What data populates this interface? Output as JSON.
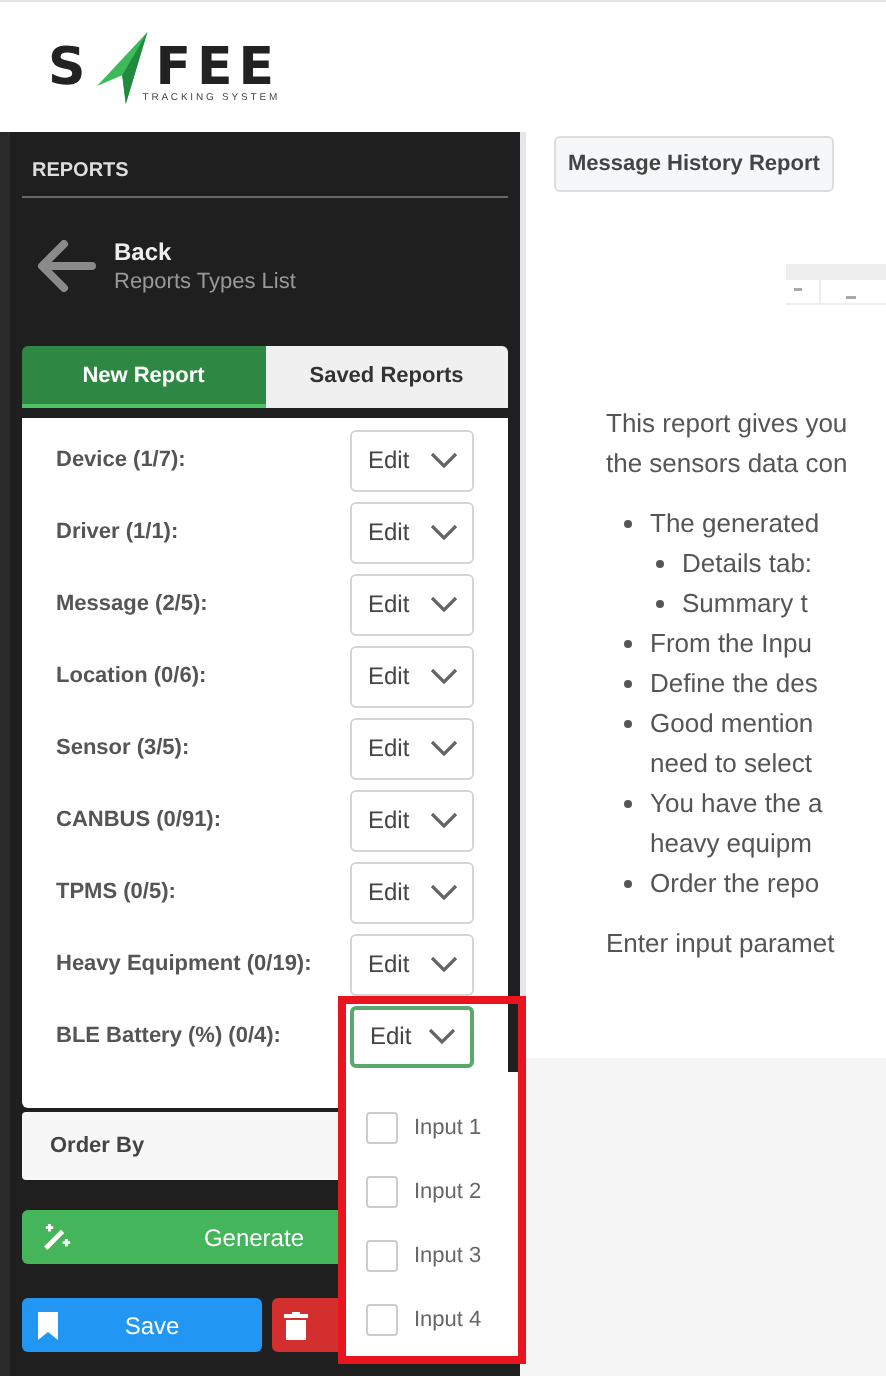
{
  "logo": {
    "left": "S",
    "right": "FEE",
    "tagline": "TRACKING SYSTEM"
  },
  "sidebar": {
    "section_title": "REPORTS",
    "back": {
      "title": "Back",
      "subtitle": "Reports Types List"
    },
    "tabs": [
      {
        "label": "New Report",
        "selected": true
      },
      {
        "label": "Saved Reports",
        "selected": false
      }
    ],
    "filters": [
      {
        "label": "Device (1/7):",
        "button": "Edit",
        "open": false
      },
      {
        "label": "Driver (1/1):",
        "button": "Edit",
        "open": false
      },
      {
        "label": "Message (2/5):",
        "button": "Edit",
        "open": false
      },
      {
        "label": "Location (0/6):",
        "button": "Edit",
        "open": false
      },
      {
        "label": "Sensor (3/5):",
        "button": "Edit",
        "open": false
      },
      {
        "label": "CANBUS (0/91):",
        "button": "Edit",
        "open": false
      },
      {
        "label": "TPMS (0/5):",
        "button": "Edit",
        "open": false
      },
      {
        "label": "Heavy Equipment (0/19):",
        "button": "Edit",
        "open": false
      },
      {
        "label": "BLE Battery (%) (0/4):",
        "button": "Edit",
        "open": true
      }
    ],
    "dropdown_options": [
      {
        "label": "Input 1",
        "checked": false
      },
      {
        "label": "Input 2",
        "checked": false
      },
      {
        "label": "Input 3",
        "checked": false
      },
      {
        "label": "Input 4",
        "checked": false
      }
    ],
    "order_by": "Order By",
    "generate_button": "Generate",
    "save_button": "Save"
  },
  "main": {
    "legend": "Message History Report",
    "intro": [
      "This report gives you",
      "the sensors data con"
    ],
    "bullets": [
      {
        "lines": [
          "The generated"
        ],
        "children": [
          {
            "lines": [
              "Details tab:"
            ]
          },
          {
            "lines": [
              "Summary t"
            ]
          }
        ]
      },
      {
        "lines": [
          "From the Inpu"
        ]
      },
      {
        "lines": [
          "Define the des"
        ]
      },
      {
        "lines": [
          "Good mention",
          "need to select"
        ]
      },
      {
        "lines": [
          "You have the a",
          "heavy equipm"
        ]
      },
      {
        "lines": [
          "Order the repo"
        ]
      }
    ],
    "footer": "Enter input paramet"
  }
}
